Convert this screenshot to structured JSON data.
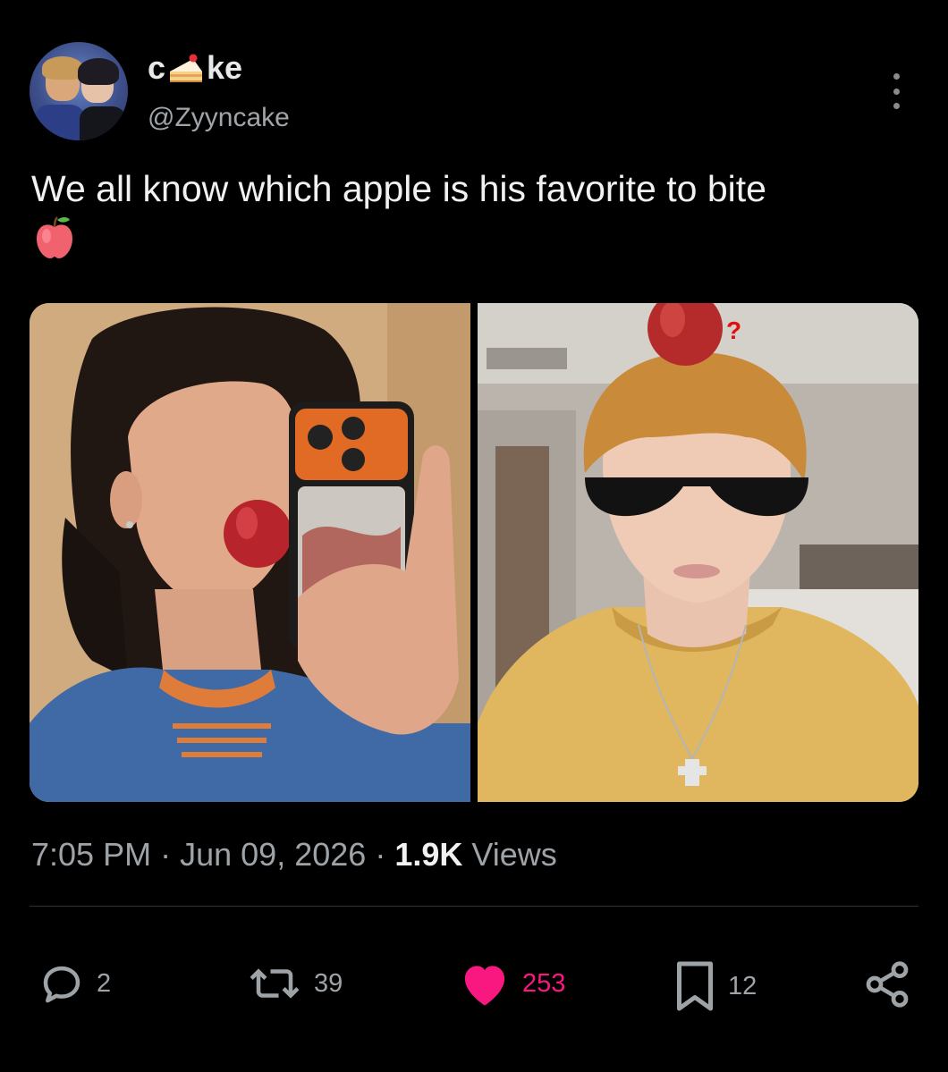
{
  "author": {
    "display_name_start": "c",
    "display_name_emoji": "cake-slice-icon",
    "display_name_end": "ke",
    "handle": "@Zyyncake"
  },
  "tweet": {
    "text": "We all know which apple is his favorite to bite",
    "emoji": "red-apple-icon"
  },
  "media": {
    "images": [
      "photo-left",
      "photo-right"
    ],
    "overlay_mark": "?"
  },
  "meta": {
    "time": "7:05 PM",
    "sep1": "·",
    "date": "Jun 09, 2026",
    "sep2": "·",
    "views_count": "1.9K",
    "views_label": "Views"
  },
  "actions": {
    "replies": "2",
    "reposts": "39",
    "likes": "253",
    "bookmarks": "12"
  },
  "colors": {
    "background": "#000000",
    "like_accent": "#f91880",
    "muted_text": "#9ea3a8",
    "divider": "#2f3336"
  }
}
